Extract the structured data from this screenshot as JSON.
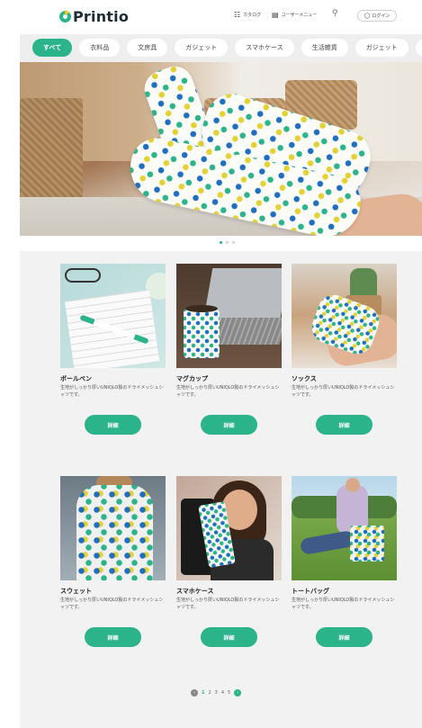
{
  "header": {
    "logo": "Printio",
    "nav": [
      {
        "icon": "book-icon",
        "label": "カタログ"
      },
      {
        "icon": "clipboard-icon",
        "label": "ユーザーメニュー"
      }
    ],
    "search_icon": "search-icon",
    "login": {
      "icon": "user-circle-icon",
      "label": "ログイン"
    }
  },
  "categories": [
    "すべて",
    "衣料品",
    "文房具",
    "ガジェット",
    "スマホケース",
    "生活雑貨",
    "ガジェット",
    "ガジ"
  ],
  "active_category": "すべて",
  "carousel": {
    "slides": 3,
    "active": 1
  },
  "products": [
    {
      "name": "ボールペン",
      "desc": "生地がしっかり厚いUNIQLO製のドライメッシュシャツです。",
      "button": "詳細"
    },
    {
      "name": "マグカップ",
      "desc": "生地がしっかり厚いUNIQLO製のドライメッシュシャツです。",
      "button": "詳細"
    },
    {
      "name": "ソックス",
      "desc": "生地がしっかり厚いUNIQLO製のドライメッシュシャツです。",
      "button": "詳細"
    },
    {
      "name": "スウェット",
      "desc": "生地がしっかり厚いUNIQLO製のドライメッシュシャツです。",
      "button": "詳細"
    },
    {
      "name": "スマホケース",
      "desc": "生地がしっかり厚いUNIQLO製のドライメッシュシャツです。",
      "button": "詳細"
    },
    {
      "name": "トートバッグ",
      "desc": "生地がしっかり厚いUNIQLO製のドライメッシュシャツです。",
      "button": "詳細"
    }
  ],
  "pagination": {
    "pages": [
      "1",
      "2",
      "3",
      "4",
      "5"
    ],
    "current": "1",
    "prev_icon": "chevron-left-icon",
    "next_icon": "chevron-right-icon"
  },
  "colors": {
    "accent": "#2bb38a",
    "accent_secondary": "#f5c518",
    "background": "#f2f2f2"
  }
}
